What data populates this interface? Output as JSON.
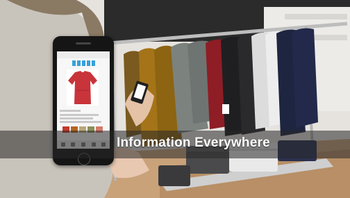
{
  "caption": {
    "text": "Information Everywhere"
  },
  "colors": {
    "caption_band": "#282828",
    "caption_text": "#ffffff",
    "app_accent": "#3aa0d8",
    "featured_garment": "#c8343a",
    "phone_body": "#151515"
  },
  "phone": {
    "product_swatches": [
      "#c0392b",
      "#b5651d",
      "#b9a77a",
      "#8a8f5a",
      "#d47a6a"
    ]
  }
}
